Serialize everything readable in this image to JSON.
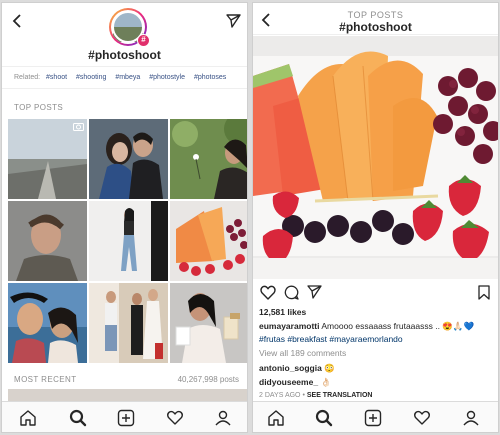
{
  "left": {
    "title": "#photoshoot",
    "related_label": "Related:",
    "related_tags": [
      "#shoot",
      "#shooting",
      "#mbeya",
      "#photostyle",
      "#photoses"
    ],
    "top_posts_label": "TOP POSTS",
    "most_recent_label": "MOST RECENT",
    "posts_count": "40,267,998 posts"
  },
  "right": {
    "header_label": "TOP POSTS",
    "title": "#photoshoot",
    "likes": "12,581 likes",
    "caption_user": "eumayaramotti",
    "caption_text": "Amoooo essaaass frutaaasss .. 😍🙏🏻💙",
    "caption_tags": "#frutas #breakfast #mayaraemorlando",
    "view_comments": "View all 189 comments",
    "comment1_user": "antonio_soggia",
    "comment1_text": "😳",
    "comment2_user": "didyouseeme_",
    "comment2_text": "👌🏻",
    "time": "2 DAYS AGO",
    "dot": "•",
    "see_translation": "SEE TRANSLATION"
  },
  "colors": {
    "link_blue": "#003569",
    "tag_blue": "#385185",
    "grey_text": "#8e8e8e",
    "hashtag_badge": "#e1306c"
  },
  "icons": [
    "back-chevron-icon",
    "send-icon",
    "home-icon",
    "search-icon",
    "add-icon",
    "heart-icon",
    "profile-icon",
    "comment-icon",
    "bookmark-icon",
    "more-icon"
  ]
}
